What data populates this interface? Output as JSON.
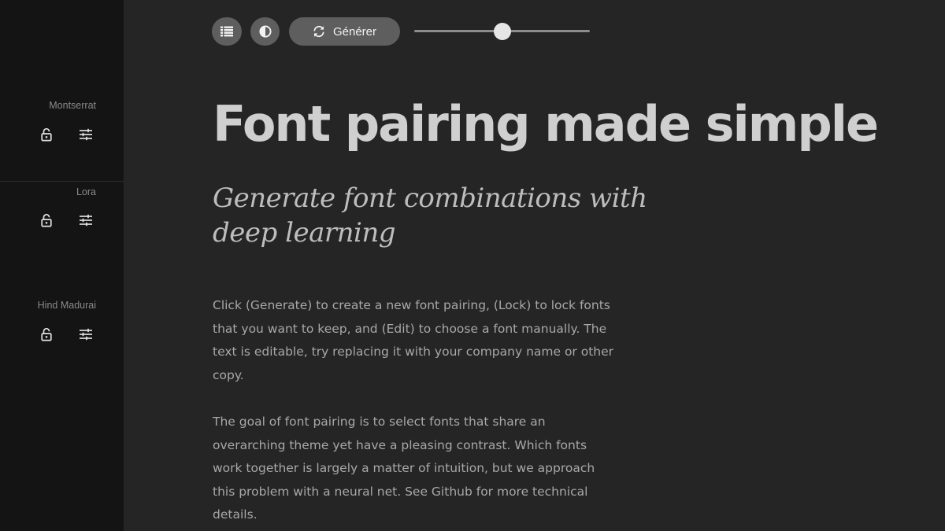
{
  "toolbar": {
    "list_icon": "list-icon",
    "contrast_icon": "contrast-icon",
    "generate_icon": "refresh-icon",
    "generate_label": "Générer",
    "slider_value": 0.5
  },
  "sidebar": {
    "fonts": [
      {
        "name": "Montserrat",
        "lock_icon": "unlock-icon",
        "edit_icon": "sliders-icon"
      },
      {
        "name": "Lora",
        "lock_icon": "unlock-icon",
        "edit_icon": "sliders-icon"
      },
      {
        "name": "Hind Madurai",
        "lock_icon": "unlock-icon",
        "edit_icon": "sliders-icon"
      }
    ]
  },
  "main": {
    "headline": "Font pairing made simple",
    "subheadline": "Generate font combinations with deep learning",
    "paragraphs": [
      "Click (Generate) to create a new font pairing, (Lock) to lock fonts that you want to keep, and (Edit) to choose a font manually. The text is editable, try replacing it with your company name or other copy.",
      "The goal of font pairing is to select fonts that share an overarching theme yet have a pleasing contrast. Which fonts work together is largely a matter of intuition, but we approach this problem with a neural net. See Github for more technical details."
    ]
  },
  "colors": {
    "background": "#252525",
    "sidebar": "#141414",
    "button": "#5e5e5e",
    "headline": "#cfcfcf",
    "body_text": "#a8a8a8"
  }
}
